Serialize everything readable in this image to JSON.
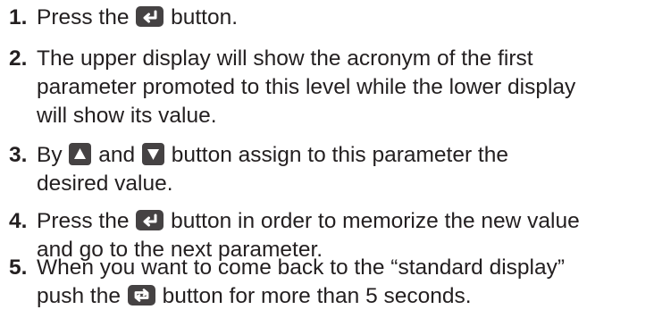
{
  "steps": [
    {
      "number": "1.",
      "lines": [
        "Press the",
        "button."
      ]
    },
    {
      "number": "2.",
      "lines": [
        "The upper display will show the acronym of the first",
        "parameter promoted to this level while the lower display",
        "will show its value."
      ]
    },
    {
      "number": "3.",
      "lines": [
        "By",
        "and",
        "button assign to this parameter the",
        "desired value."
      ]
    },
    {
      "number": "4.",
      "lines": [
        "Press the",
        "button in order to memorize the new value",
        "and go to the next parameter."
      ]
    },
    {
      "number": "5.",
      "lines": [
        "When you want to come back to the “standard display”",
        "push the",
        "button for more than 5 seconds."
      ]
    }
  ],
  "icons": {
    "enter": "enter-icon",
    "up": "up-arrow-icon",
    "down": "down-arrow-icon",
    "loop": "loop-icon"
  },
  "colors": {
    "text": "#231f20",
    "button": "#454243"
  }
}
